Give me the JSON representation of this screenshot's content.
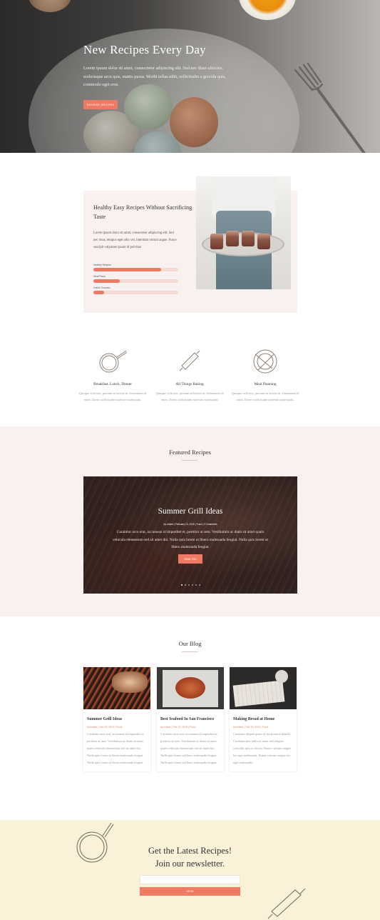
{
  "hero": {
    "title": "New Recipes Every Day",
    "body": "Lorem ipsum dolor sit amet, consectetur adipiscing elit. Sed nec diam ultricies, scelerisque arcu quis, mattis purus. Morbi tellus nibh, sollicitudin a gravida quis, commodo eget eros.",
    "button": "BROWSE RECIPES"
  },
  "about": {
    "title": "Healthy Easy Recipes Without Sacrificing Taste",
    "body": "Lorem ipsum dolor sit amet, consectetur adipiscing elit. Sed nec risus, tempus eget odio vel, interdum rutrum augue. Fusce suscipit vulputate ipsum id pulvinar",
    "bars": [
      {
        "label": "Healthy Recipes",
        "value": 0.8
      },
      {
        "label": "Meal Plans",
        "value": 0.31
      },
      {
        "label": "Online Courses",
        "value": 0.13
      }
    ]
  },
  "features": [
    {
      "icon": "frying-pan-icon",
      "title": "Breakfast, Lunch, Dinner",
      "body": "Quisque velit nisi, pretium ut lacinia in, elementum id enim. Donec sollicitudin molestie malesuada."
    },
    {
      "icon": "rolling-pin-icon",
      "title": "All Things Baking",
      "body": "Quisque velit nisi, pretium ut lacinia in, elementum id enim. Donec sollicitudin molestie malesuada."
    },
    {
      "icon": "plate-cutlery-icon",
      "title": "Meal Planning",
      "body": "Quisque velit nisi, pretium ut lacinia in, elementum id enim. Donec sollicitudin molestie malesuada."
    }
  ],
  "featured": {
    "title": "Featured Recipes",
    "slide": {
      "title": "Summer Grill Ideas",
      "meta": "by ember | February 13, 2019 | Food | 0 Comments",
      "body": "Curabitur arcu erat, accumsan id imperdiet et, porttitor at sem. Vestibulum ac diam sit amet quam vehicula elementum sed sit amet dui. Nulla quis lorem ut libero malesuada feugiat. Nulla quis lorem ut libero malesuada feugiat.",
      "button": "READ THIS"
    },
    "dot_count": 6,
    "active_dot": 0
  },
  "blog": {
    "title": "Our Blog",
    "posts": [
      {
        "title": "Summer Grill Ideas",
        "meta": "by ember | Feb 13, 2019 | Food",
        "body": "Curabitur arcu erat, accumsan id imperdiet et, porttitor at sem. Vestibulum ac diam sit amet quam vehicula elementum sed sit amet dui. Nulla quis lorem ut libero malesuada feugiat. Nulla quis lorem ut libero malesuada feugiat."
      },
      {
        "title": "Best Seafood In San Francisco",
        "meta": "by ember | Feb 13, 2019 | Food",
        "body": "Curabitur arcu erat, accumsan id imperdiet et, porttitor at sem. Vestibulum ac diam sit amet quam vehicula elementum sed sit amet dui. Nulla quis lorem ut libero malesuada feugiat. Nulla quis lorem ut libero malesuada feugiat."
      },
      {
        "title": "Making Bread at Home",
        "meta": "by ember | Feb 13, 2019 | Food",
        "body": "Curabitur aliquet quam id dui posuere blandit. Curabitur non nulla sit amet nisl tempus convallis quis ac lectus. Donec rutrum congue leo eget malesuada. Donec rutrum congue leo eget malesuada."
      }
    ]
  },
  "newsletter": {
    "title_line1": "Get the Latest Recipes!",
    "title_line2": "Join our newsletter.",
    "input_placeholder": "",
    "button": "SEND"
  },
  "colors": {
    "accent": "#ef7a63",
    "blush": "#f8f1ef",
    "cream": "#faf1d9"
  }
}
